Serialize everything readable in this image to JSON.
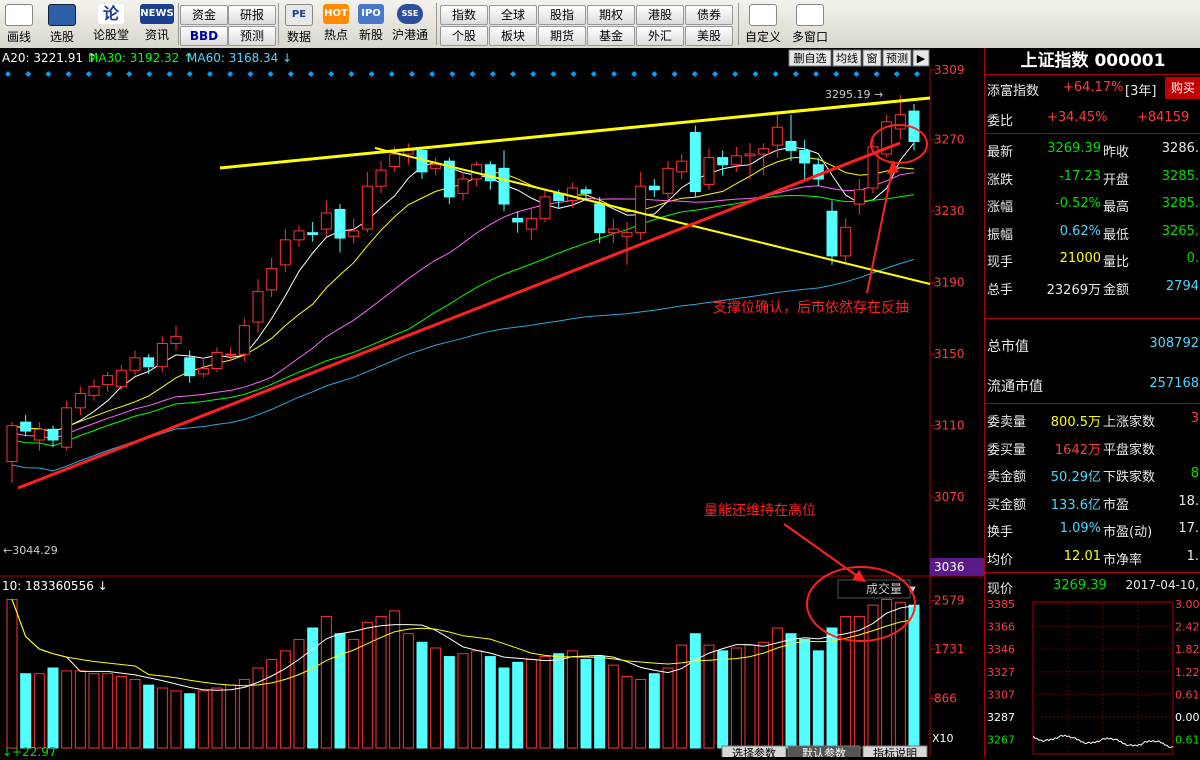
{
  "toolbar": {
    "big_buttons": [
      {
        "label": "画线",
        "icon": "pencil-icon"
      },
      {
        "label": "选股",
        "icon": "monitor-icon"
      },
      {
        "label": "论股堂",
        "icon": "lun-icon",
        "icon_text": "论"
      },
      {
        "label": "资讯",
        "icon": "news-icon",
        "icon_text": "NEWS"
      }
    ],
    "small_buttons_a": [
      "资金",
      "研报",
      "BBD",
      "预测"
    ],
    "big_buttons_b": [
      {
        "label": "数据",
        "icon": "pe-icon",
        "icon_text": "PE"
      },
      {
        "label": "热点",
        "icon": "fire-icon",
        "icon_text": "HOT"
      },
      {
        "label": "新股",
        "icon": "ipo-icon",
        "icon_text": "IPO"
      },
      {
        "label": "沪港通",
        "icon": "sse-hkex-icon",
        "icon_text": "SSE"
      }
    ],
    "small_buttons_b": [
      "指数",
      "全球",
      "股指",
      "期权",
      "港股",
      "债券",
      "个股",
      "板块",
      "期货",
      "基金",
      "外汇",
      "美股"
    ],
    "big_buttons_c": [
      {
        "label": "自定义",
        "icon": "custom-icon"
      },
      {
        "label": "多窗口",
        "icon": "windows-icon"
      }
    ]
  },
  "chart_header": {
    "ma20": "A20: 3221.91",
    "ma30": "MA30: 3192.32",
    "ma60": "MA60: 3168.34",
    "buttons": [
      "删自选",
      "均线",
      "窗",
      "预测"
    ]
  },
  "chart_data": {
    "type": "candlestick",
    "price_axis": {
      "ticks": [
        3309,
        3270,
        3230,
        3190,
        3150,
        3110,
        3070,
        3036
      ],
      "ylim": [
        3036,
        3309
      ]
    },
    "high_label": "3295.19",
    "low_label": "3044.29",
    "current_price_tag": "3036",
    "candles": [
      [
        3090,
        3110,
        3078,
        3112
      ],
      [
        3112,
        3107,
        3104,
        3116
      ],
      [
        3102,
        3108,
        3096,
        3112
      ],
      [
        3108,
        3102,
        3098,
        3110
      ],
      [
        3098,
        3120,
        3096,
        3124
      ],
      [
        3120,
        3128,
        3116,
        3132
      ],
      [
        3127,
        3132,
        3124,
        3136
      ],
      [
        3133,
        3138,
        3129,
        3140
      ],
      [
        3132,
        3141,
        3130,
        3144
      ],
      [
        3141,
        3148,
        3138,
        3152
      ],
      [
        3148,
        3143,
        3139,
        3150
      ],
      [
        3143,
        3156,
        3140,
        3160
      ],
      [
        3156,
        3160,
        3152,
        3166
      ],
      [
        3148,
        3138,
        3134,
        3152
      ],
      [
        3139,
        3142,
        3137,
        3148
      ],
      [
        3142,
        3151,
        3140,
        3154
      ],
      [
        3150,
        3150,
        3146,
        3154
      ],
      [
        3150,
        3166,
        3146,
        3170
      ],
      [
        3168,
        3185,
        3162,
        3192
      ],
      [
        3186,
        3198,
        3182,
        3204
      ],
      [
        3200,
        3214,
        3196,
        3220
      ],
      [
        3214,
        3219,
        3210,
        3222
      ],
      [
        3218,
        3217,
        3213,
        3224
      ],
      [
        3220,
        3229,
        3216,
        3236
      ],
      [
        3231,
        3215,
        3207,
        3234
      ],
      [
        3216,
        3219,
        3212,
        3226
      ],
      [
        3220,
        3244,
        3218,
        3252
      ],
      [
        3244,
        3253,
        3240,
        3258
      ],
      [
        3255,
        3262,
        3252,
        3266
      ],
      [
        3262,
        3264,
        3256,
        3268
      ],
      [
        3264,
        3252,
        3248,
        3266
      ],
      [
        3254,
        3256,
        3250,
        3260
      ],
      [
        3258,
        3238,
        3234,
        3260
      ],
      [
        3240,
        3248,
        3236,
        3252
      ],
      [
        3248,
        3256,
        3244,
        3258
      ],
      [
        3256,
        3247,
        3242,
        3258
      ],
      [
        3254,
        3234,
        3230,
        3264
      ],
      [
        3226,
        3224,
        3218,
        3230
      ],
      [
        3220,
        3226,
        3214,
        3232
      ],
      [
        3226,
        3238,
        3224,
        3242
      ],
      [
        3240,
        3236,
        3232,
        3242
      ],
      [
        3236,
        3243,
        3232,
        3246
      ],
      [
        3242,
        3240,
        3236,
        3244
      ],
      [
        3234,
        3218,
        3212,
        3238
      ],
      [
        3218,
        3220,
        3212,
        3226
      ],
      [
        3216,
        3218,
        3200,
        3224
      ],
      [
        3218,
        3244,
        3214,
        3252
      ],
      [
        3244,
        3242,
        3238,
        3248
      ],
      [
        3240,
        3254,
        3236,
        3258
      ],
      [
        3252,
        3258,
        3248,
        3262
      ],
      [
        3274,
        3241,
        3238,
        3278
      ],
      [
        3245,
        3260,
        3242,
        3265
      ],
      [
        3260,
        3256,
        3250,
        3264
      ],
      [
        3256,
        3261,
        3252,
        3266
      ],
      [
        3261,
        3262,
        3248,
        3268
      ],
      [
        3262,
        3265,
        3250,
        3268
      ],
      [
        3267,
        3277,
        3260,
        3286
      ],
      [
        3269,
        3264,
        3258,
        3284
      ],
      [
        3264,
        3257,
        3248,
        3270
      ],
      [
        3256,
        3248,
        3244,
        3260
      ],
      [
        3230,
        3205,
        3200,
        3236
      ],
      [
        3205,
        3221,
        3200,
        3226
      ],
      [
        3234,
        3242,
        3228,
        3248
      ],
      [
        3243,
        3266,
        3240,
        3272
      ],
      [
        3262,
        3280,
        3260,
        3284
      ],
      [
        3276,
        3284,
        3270,
        3295
      ],
      [
        3286,
        3269,
        3264,
        3290
      ]
    ],
    "volume_axis": {
      "ticks": [
        2579,
        1731,
        866
      ],
      "unit": "X10"
    },
    "volume_header": "10: 183360556",
    "volume_legend": "成交量",
    "volume_bottom_label": "+22.97",
    "volume_tabs": [
      "选择参数",
      "默认参数",
      "指标说明"
    ],
    "annotations": [
      "支撑位确认，后市依然存在反抽",
      "量能还维持在高位"
    ]
  },
  "side": {
    "title": "上证指数 000001",
    "tianfu": {
      "label": "添富指数",
      "value": "+64.17%",
      "period": "[3年]",
      "buy": "购买"
    },
    "weibi": {
      "label": "委比",
      "value": "+34.45%",
      "value2": "+84159"
    },
    "rows1": [
      {
        "l1": "最新",
        "v1": "3269.39",
        "c1": "green",
        "l2": "昨收",
        "v2": "3286.",
        "c2": "white"
      },
      {
        "l1": "涨跌",
        "v1": "-17.23",
        "c1": "green",
        "l2": "开盘",
        "v2": "3285.",
        "c2": "green"
      },
      {
        "l1": "涨幅",
        "v1": "-0.52%",
        "c1": "green",
        "l2": "最高",
        "v2": "3285.",
        "c2": "green"
      },
      {
        "l1": "振幅",
        "v1": "0.62%",
        "c1": "cyan",
        "l2": "最低",
        "v2": "3265.",
        "c2": "green"
      },
      {
        "l1": "现手",
        "v1": "21000",
        "c1": "yellow",
        "l2": "量比",
        "v2": "0.",
        "c2": "green"
      },
      {
        "l1": "总手",
        "v1": "23269万",
        "c1": "white",
        "l2": "金额",
        "v2": "2794",
        "c2": "cyan"
      }
    ],
    "market_cap": {
      "label": "总市值",
      "value": "308792"
    },
    "float_cap": {
      "label": "流通市值",
      "value": "257168"
    },
    "rows2": [
      {
        "l1": "委卖量",
        "v1": "800.5万",
        "c1": "yellow",
        "l2": "上涨家数",
        "v2": "3",
        "c2": "red"
      },
      {
        "l1": "委买量",
        "v1": "1642万",
        "c1": "red",
        "l2": "平盘家数",
        "v2": "",
        "c2": "white"
      },
      {
        "l1": "卖金额",
        "v1": "50.29亿",
        "c1": "cyan",
        "l2": "下跌家数",
        "v2": "8",
        "c2": "green"
      },
      {
        "l1": "买金额",
        "v1": "133.6亿",
        "c1": "cyan",
        "l2": "市盈",
        "v2": "18.",
        "c2": "white"
      },
      {
        "l1": "换手",
        "v1": "1.09%",
        "c1": "cyan",
        "l2": "市盈(动)",
        "v2": "17.",
        "c2": "white"
      },
      {
        "l1": "均价",
        "v1": "12.01",
        "c1": "yellow",
        "l2": "市净率",
        "v2": "1.",
        "c2": "white"
      }
    ],
    "now": {
      "label": "现价",
      "price": "3269.39",
      "date": "2017-04-10,"
    },
    "mini_left": [
      "3385",
      "3366",
      "3346",
      "3327",
      "3307",
      "3287",
      "3267"
    ],
    "mini_right": [
      "3.00",
      "2.42",
      "1.82",
      "1.22",
      "0.61",
      "0.00",
      "0.61"
    ]
  }
}
